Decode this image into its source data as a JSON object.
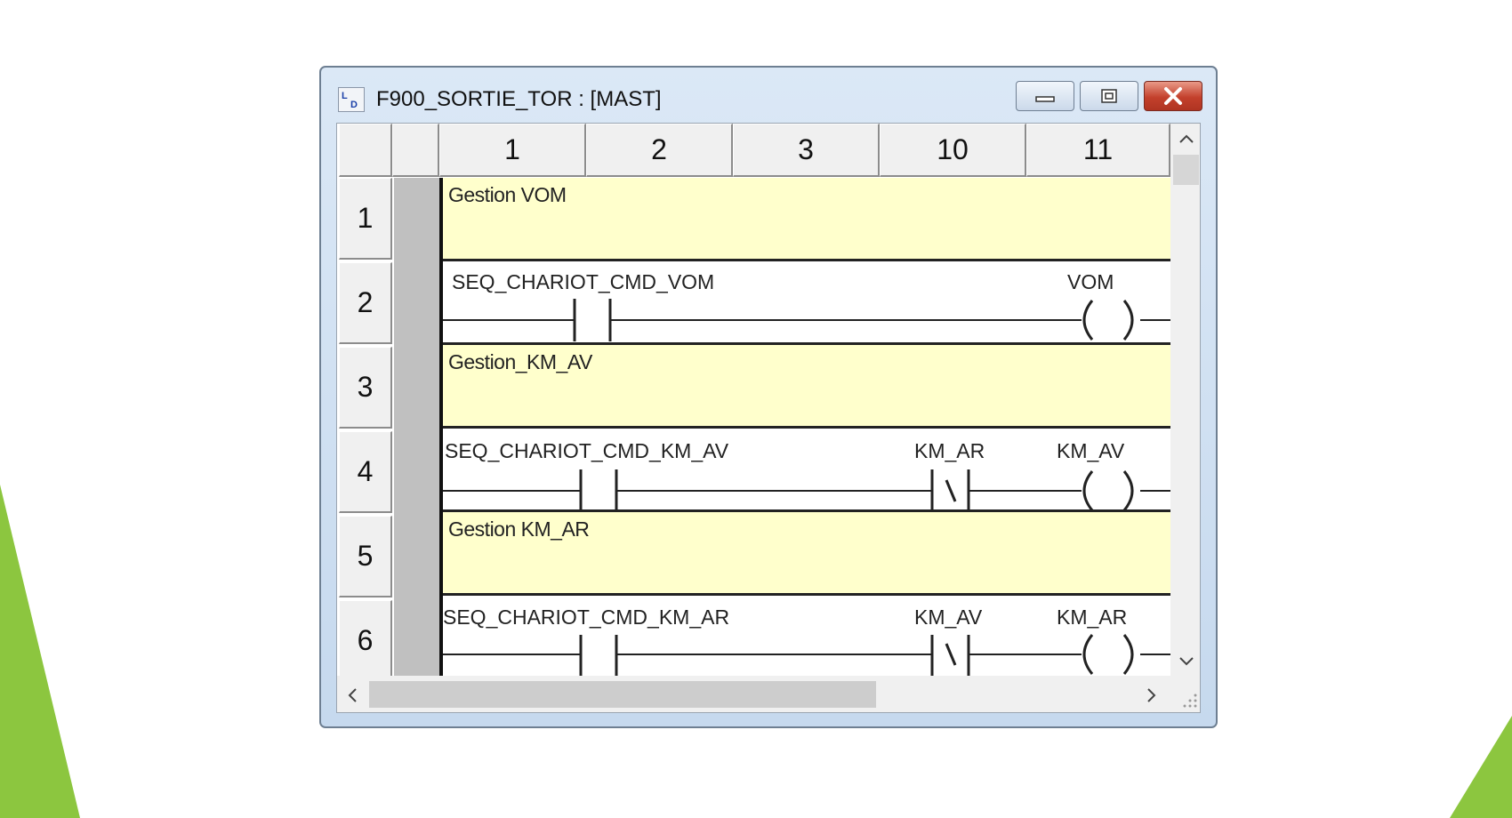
{
  "window": {
    "title": "F900_SORTIE_TOR : [MAST]",
    "app_icon": "ld-editor-icon"
  },
  "column_headers": [
    "1",
    "2",
    "3",
    "10",
    "11"
  ],
  "row_headers": [
    "1",
    "2",
    "3",
    "4",
    "5",
    "6"
  ],
  "rungs": [
    {
      "type": "comment",
      "text": "Gestion VOM"
    },
    {
      "type": "logic",
      "contact": "SEQ_CHARIOT_CMD_VOM",
      "coil": "VOM"
    },
    {
      "type": "comment",
      "text": "Gestion_KM_AV"
    },
    {
      "type": "logic",
      "contact": "SEQ_CHARIOT_CMD_KM_AV",
      "nc_contact": "KM_AR",
      "coil": "KM_AV"
    },
    {
      "type": "comment",
      "text": "Gestion KM_AR"
    },
    {
      "type": "logic",
      "contact": "SEQ_CHARIOT_CMD_KM_AR",
      "nc_contact": "KM_AV",
      "coil": "KM_AR"
    }
  ],
  "colors": {
    "comment_bg": "#ffffcc",
    "accent_green": "#8cc63f",
    "close_button": "#c3402c"
  }
}
